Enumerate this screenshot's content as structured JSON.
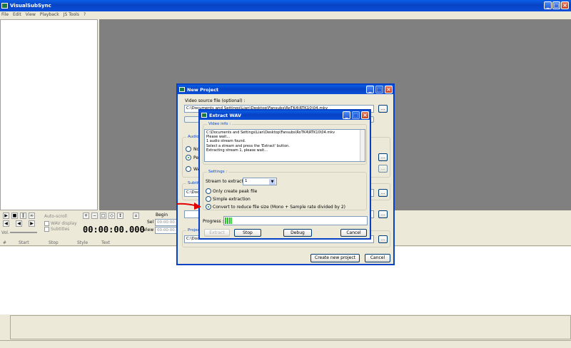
{
  "app": {
    "title": "VisualSubSync",
    "menu": [
      "File",
      "Edit",
      "View",
      "Playback",
      "JS Tools",
      "?"
    ]
  },
  "toolbar": {
    "autoscroll_label": "Auto-scroll",
    "wav_display_label": "WAV display",
    "subtitles_label": "Subtitles",
    "vol_label": "Vol.",
    "timecode": "00:00:00.000",
    "begin_label": "Begin",
    "sel_label": "Sel",
    "view_label": "View",
    "sel_value": "00:00:00.0",
    "view_value": "00:00:00.0"
  },
  "table": {
    "columns": [
      "#",
      "Start",
      "Stop",
      "Style",
      "Text"
    ]
  },
  "new_project": {
    "title": "New Project",
    "video_source_label": "Video source file (optional) :",
    "video_source_value": "C:\\Documents and Settings\\Lian\\Desktop\\Fansubs\\RoTK4\\RTK10\\04.mkv",
    "audio_group_label": "Audio n",
    "audio_options": [
      "No a",
      "Peak",
      "WAV"
    ],
    "subtitle_group_label": "Subtitl",
    "subtitle_value": "C:\\Docu",
    "project_group_label": "Project",
    "project_value": "C:\\Docu",
    "browse_label": "...",
    "create_button": "Create new project",
    "cancel_button": "Cancel"
  },
  "extract_wav": {
    "title": "Extract WAV",
    "video_info_label": "Video info :",
    "video_info_lines": [
      "C:\\Documents and Settings\\Lian\\Desktop\\Fansubs\\RoTK4\\RTK10\\04.mkv",
      "Please wait...",
      "1 audio stream found.",
      "Select a stream and press the 'Extract' button.",
      "Extracting stream 1, please wait..."
    ],
    "settings_label": "Settings :",
    "stream_label": "Stream to extract :",
    "stream_value": "1",
    "options": [
      "Only create peak file",
      "Simple extraction",
      "Convert to reduce file size (Mono + Sample rate divided by 2)"
    ],
    "selected_option": 2,
    "progress_label": "Progress :",
    "progress_fraction": 0.05,
    "extract_button": "Extract",
    "stop_button": "Stop",
    "debug_button": "Debug",
    "cancel_button": "Cancel"
  },
  "colors": {
    "title_blue": "#0842c4",
    "workspace_gray": "#808080",
    "progress_green": "#27c427",
    "arrow_red": "#e00000"
  }
}
